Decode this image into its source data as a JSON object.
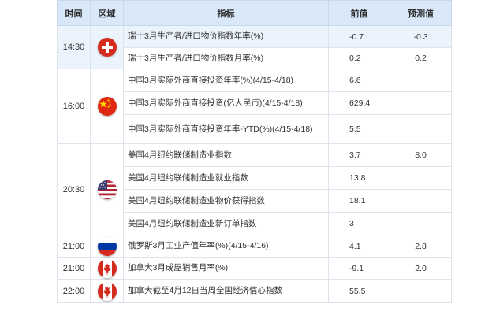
{
  "headers": {
    "time": "时间",
    "region": "区域",
    "indicator": "指标",
    "previous": "前值",
    "forecast": "预测值"
  },
  "colors": {
    "header_bg": "#d8e8f8",
    "highlight_row_bg": "#ebf3fc",
    "border": "#dde4ec"
  },
  "groups": [
    {
      "time": "14:30",
      "flag": "switzerland-flag-icon",
      "rows": [
        {
          "indicator": "瑞士3月生产者/进口物价指数年率(%)",
          "previous": "-0.7",
          "forecast": "-0.3"
        },
        {
          "indicator": "瑞士3月生产者/进口物价指数月率(%)",
          "previous": "0.2",
          "forecast": "0.2"
        }
      ]
    },
    {
      "time": "16:00",
      "flag": "china-flag-icon",
      "rows": [
        {
          "indicator": "中国3月实际外商直接投资年率(%)(4/15-4/18)",
          "previous": "6.6",
          "forecast": ""
        },
        {
          "indicator": "中国3月实际外商直接投资(亿人民币)(4/15-4/18)",
          "previous": "629.4",
          "forecast": ""
        },
        {
          "indicator": "中国3月实际外商直接投资年率-YTD(%)(4/15-4/18)",
          "previous": "5.5",
          "forecast": ""
        }
      ]
    },
    {
      "time": "20:30",
      "flag": "usa-flag-icon",
      "rows": [
        {
          "indicator": "美国4月纽约联储制造业指数",
          "previous": "3.7",
          "forecast": "8.0"
        },
        {
          "indicator": "美国4月纽约联储制造业就业指数",
          "previous": "13.8",
          "forecast": ""
        },
        {
          "indicator": "美国4月纽约联储制造业物价获得指数",
          "previous": "18.1",
          "forecast": ""
        },
        {
          "indicator": "美国4月纽约联储制造业新订单指数",
          "previous": "3",
          "forecast": ""
        }
      ]
    },
    {
      "time": "21:00",
      "flag": "russia-flag-icon",
      "rows": [
        {
          "indicator": "俄罗斯3月工业产值年率(%)(4/15-4/16)",
          "previous": "4.1",
          "forecast": "2.8"
        }
      ]
    },
    {
      "time": "21:00",
      "flag": "canada-flag-icon",
      "rows": [
        {
          "indicator": "加拿大3月成屋销售月率(%)",
          "previous": "-9.1",
          "forecast": "2.0"
        }
      ]
    },
    {
      "time": "22:00",
      "flag": "canada-flag-icon",
      "rows": [
        {
          "indicator": "加拿大截至4月12日当周全国经济信心指数",
          "previous": "55.5",
          "forecast": ""
        }
      ]
    }
  ]
}
